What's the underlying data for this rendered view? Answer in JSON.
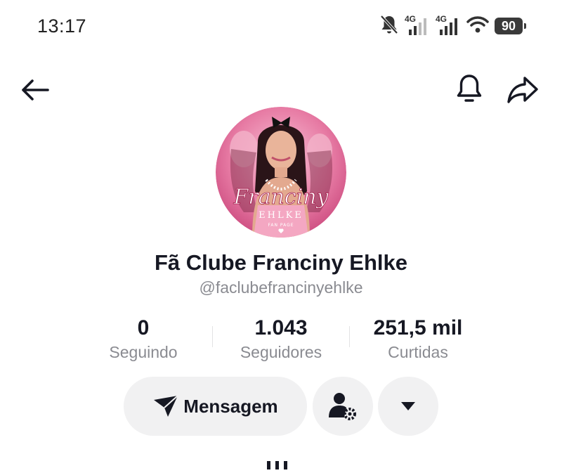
{
  "status_bar": {
    "time": "13:17",
    "signal_1_label": "4G",
    "signal_2_label": "4G",
    "battery": "90"
  },
  "header": {
    "back_icon": "arrow-left-icon",
    "bell_icon": "bell-icon",
    "share_icon": "share-arrow-icon"
  },
  "profile": {
    "avatar_text_main": "Franciny",
    "avatar_text_sub": "EHLKE",
    "avatar_text_tag": "FAN PAGE",
    "name": "Fã Clube Franciny Ehlke",
    "handle": "@faclubefrancinyehlke"
  },
  "stats": [
    {
      "value": "0",
      "label": "Seguindo"
    },
    {
      "value": "1.043",
      "label": "Seguidores"
    },
    {
      "value": "251,5 mil",
      "label": "Curtidas"
    }
  ],
  "actions": {
    "message_label": "Mensagem",
    "message_icon": "send-icon",
    "friend_icon": "user-settings-icon",
    "more_icon": "caret-down-icon"
  },
  "colors": {
    "text": "#161823",
    "muted": "#8a8b91",
    "button_bg": "#f1f1f2",
    "avatar_pink": "#e8669a"
  }
}
